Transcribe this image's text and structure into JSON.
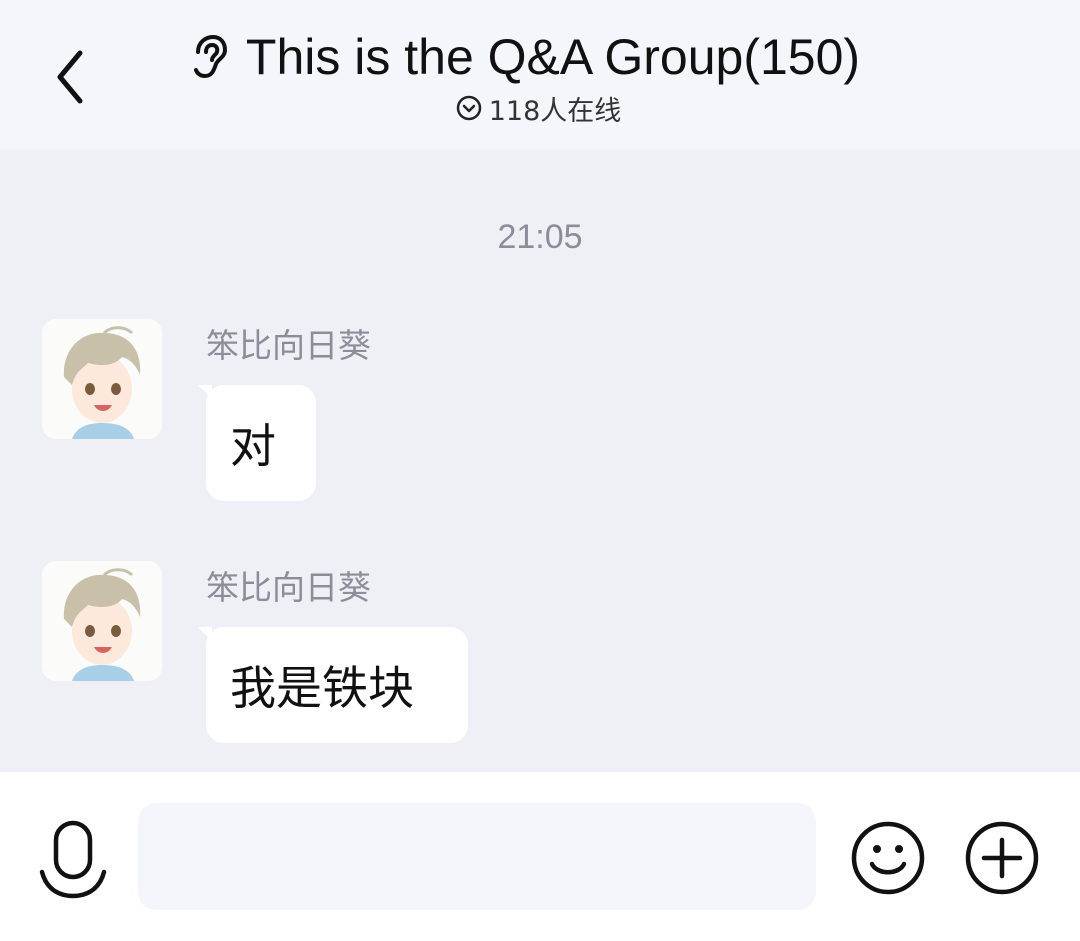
{
  "header": {
    "title": "This is the Q&A Group(150)",
    "online_text": "118人在线"
  },
  "chat": {
    "timestamp": "21:05",
    "messages": [
      {
        "sender": "笨比向日葵",
        "text": "对"
      },
      {
        "sender": "笨比向日葵",
        "text": "我是铁块"
      }
    ]
  },
  "input": {
    "value": "",
    "placeholder": ""
  },
  "icons": {
    "back": "chevron-left-icon",
    "ear": "ear-icon",
    "online": "chevron-down-circle-icon",
    "mic": "microphone-icon",
    "emoji": "smiley-icon",
    "plus": "plus-circle-icon"
  },
  "colors": {
    "background": "#eff0f5",
    "header": "#f5f6fb",
    "bubble": "#ffffff",
    "muted_text": "#8a8e99"
  }
}
